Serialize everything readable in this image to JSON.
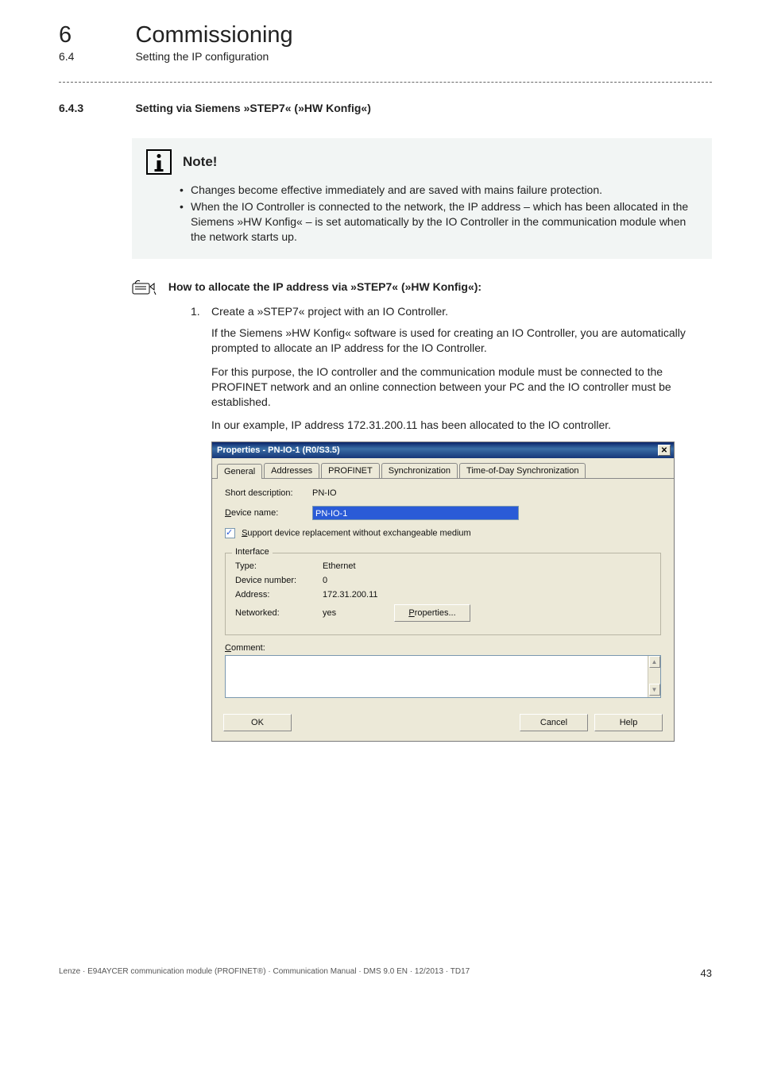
{
  "chapter": {
    "number": "6",
    "title": "Commissioning"
  },
  "subheading": {
    "number": "6.4",
    "title": "Setting the IP configuration"
  },
  "section": {
    "number": "6.4.3",
    "title": "Setting via Siemens »STEP7« (»HW Konfig«)"
  },
  "note": {
    "title": "Note!",
    "bullets": [
      "Changes become effective immediately and are saved with mains failure protection.",
      "When the IO Controller is connected to the network, the IP address – which has been allocated in the Siemens »HW Konfig«  – is set automatically by the IO Controller in the communication module when the network starts up."
    ]
  },
  "howto_heading": "How to allocate the IP address via »STEP7« (»HW Konfig«):",
  "step1": {
    "number": "1.",
    "text": "Create a »STEP7« project with an IO Controller.",
    "para1": "If the Siemens »HW Konfig« software is used for creating an IO Controller, you are automatically prompted to allocate an IP address for the IO Controller.",
    "para2": "For this purpose, the IO controller and the communication module must be connected to the PROFINET network and an online connection between your PC and the IO controller must be established.",
    "para3": "In our example, IP address 172.31.200.11 has been allocated to the IO controller."
  },
  "dialog": {
    "title": "Properties - PN-IO-1 (R0/S3.5)",
    "tabs": [
      "General",
      "Addresses",
      "PROFINET",
      "Synchronization",
      "Time-of-Day Synchronization"
    ],
    "short_desc_label": "Short description:",
    "short_desc_value": "PN-IO",
    "device_name_label": "evice name:",
    "device_name_mnemonic": "D",
    "device_name_value": "PN-IO-1",
    "support_replace_label": "upport device replacement without exchangeable medium",
    "support_replace_mnemonic": "S",
    "interface_legend": "Interface",
    "iface_type_label": "Type:",
    "iface_type_value": "Ethernet",
    "iface_devnum_label": "Device number:",
    "iface_devnum_value": "0",
    "iface_addr_label": "Address:",
    "iface_addr_value": "172.31.200.11",
    "iface_net_label": "Networked:",
    "iface_net_value": "yes",
    "properties_button": "roperties...",
    "properties_mnemonic": "P",
    "comment_label": "omment:",
    "comment_mnemonic": "C",
    "ok": "OK",
    "cancel": "Cancel",
    "help": "Help"
  },
  "footer": {
    "left": "Lenze · E94AYCER communication module (PROFINET®) · Communication Manual · DMS 9.0 EN · 12/2013 · TD17",
    "page": "43"
  }
}
